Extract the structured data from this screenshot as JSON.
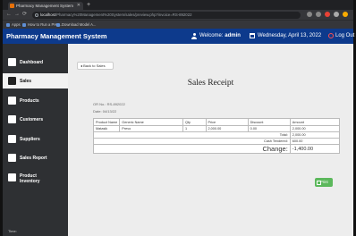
{
  "browser": {
    "tab_title": "Pharmacy Management System",
    "url_host": "localhost",
    "url_path": "/Pharmacy%20Management%20System/sales/preview.php?invoice=RS-892022",
    "bookmarks": [
      "Apps",
      "How to Run a PHP...",
      "Download Model A..."
    ]
  },
  "header": {
    "title": "Pharmacy Management System",
    "welcome_prefix": "Welcome:",
    "username": "admin",
    "date": "Wednesday, April 13, 2022",
    "logout": "Log Out"
  },
  "sidebar": {
    "items": [
      {
        "label": "Dashboard",
        "icon": "dashboard-icon"
      },
      {
        "label": "Sales",
        "icon": "cart-icon"
      },
      {
        "label": "Products",
        "icon": "products-icon"
      },
      {
        "label": "Customers",
        "icon": "customers-icon"
      },
      {
        "label": "Suppliers",
        "icon": "suppliers-icon"
      },
      {
        "label": "Sales Report",
        "icon": "report-icon"
      },
      {
        "label": "Product Inventory",
        "icon": "inventory-icon"
      }
    ],
    "footer": "Time:"
  },
  "main": {
    "back_label": "Back to Sales",
    "title": "Sales Receipt",
    "or_label": "OR No.:",
    "or_value": "RS-892022",
    "date_label": "Date:",
    "date_value": "04/13/22",
    "columns": [
      "Product Name",
      "Generic Name",
      "Qty",
      "Price",
      "Discount",
      "Amount"
    ],
    "rows": [
      [
        "Matasik",
        "Prevo",
        "1",
        "2,000.00",
        "0.00",
        "2,000.00"
      ]
    ],
    "total_label": "Total:",
    "total_value": "2,000.00",
    "cash_label": "Cash Tendered:",
    "cash_value": "600.00",
    "change_label": "Change:",
    "change_value": "-1,400.00",
    "print_label": "Print"
  },
  "colors": {
    "header_bg": "#0d3a8c",
    "sidebar_bg": "#2e3033",
    "print_button": "#5cb85c"
  }
}
